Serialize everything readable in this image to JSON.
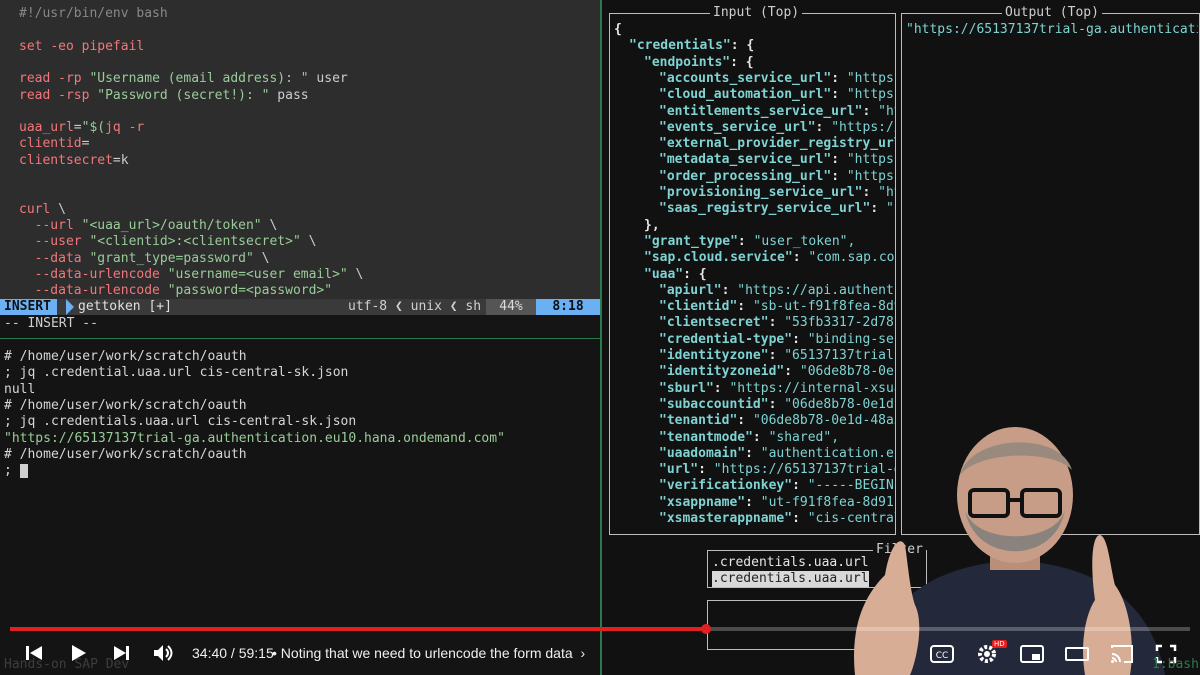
{
  "vim": {
    "lines": [
      {
        "parts": [
          {
            "t": "#!/usr/bin/env bash",
            "c": "com"
          }
        ]
      },
      {
        "parts": []
      },
      {
        "parts": [
          {
            "t": "set ",
            "c": "kw"
          },
          {
            "t": "-eo pipefail",
            "c": "kw"
          }
        ]
      },
      {
        "parts": []
      },
      {
        "parts": [
          {
            "t": "read ",
            "c": "kw"
          },
          {
            "t": "-rp ",
            "c": "kw"
          },
          {
            "t": "\"Username (email address): \"",
            "c": "str"
          },
          {
            "t": " user",
            "c": "plain"
          }
        ]
      },
      {
        "parts": [
          {
            "t": "read ",
            "c": "kw"
          },
          {
            "t": "-rsp ",
            "c": "kw"
          },
          {
            "t": "\"Password (secret!): \"",
            "c": "str"
          },
          {
            "t": " pass",
            "c": "plain"
          }
        ]
      },
      {
        "parts": []
      },
      {
        "parts": [
          {
            "t": "uaa_url",
            "c": "var"
          },
          {
            "t": "=",
            "c": "plain"
          },
          {
            "t": "\"$(",
            "c": "str"
          },
          {
            "t": "jq -r",
            "c": "kw"
          }
        ]
      },
      {
        "parts": [
          {
            "t": "clientid",
            "c": "var"
          },
          {
            "t": "=",
            "c": "plain"
          }
        ]
      },
      {
        "parts": [
          {
            "t": "clientsecret",
            "c": "var"
          },
          {
            "t": "=k",
            "c": "plain"
          }
        ]
      },
      {
        "parts": []
      },
      {
        "parts": []
      },
      {
        "parts": [
          {
            "t": "curl ",
            "c": "kw"
          },
          {
            "t": "\\",
            "c": "plain"
          }
        ]
      },
      {
        "parts": [
          {
            "t": "  --url ",
            "c": "kw"
          },
          {
            "t": "\"<uaa_url>/oauth/token\"",
            "c": "str"
          },
          {
            "t": " \\",
            "c": "plain"
          }
        ]
      },
      {
        "parts": [
          {
            "t": "  --user ",
            "c": "kw"
          },
          {
            "t": "\"<clientid>:<clientsecret>\"",
            "c": "str"
          },
          {
            "t": " \\",
            "c": "plain"
          }
        ]
      },
      {
        "parts": [
          {
            "t": "  --data ",
            "c": "kw"
          },
          {
            "t": "\"grant_type=password\"",
            "c": "str"
          },
          {
            "t": " \\",
            "c": "plain"
          }
        ]
      },
      {
        "parts": [
          {
            "t": "  --data-urlencode ",
            "c": "kw"
          },
          {
            "t": "\"username=<user email>\"",
            "c": "str"
          },
          {
            "t": " \\",
            "c": "plain"
          }
        ]
      },
      {
        "parts": [
          {
            "t": "  --data-urlencode ",
            "c": "kw"
          },
          {
            "t": "\"password=<password>\"",
            "c": "str"
          }
        ]
      }
    ],
    "status": {
      "mode": "INSERT",
      "filename": "gettoken [+]",
      "encoding": "utf-8 ❮ unix ❮ sh",
      "percent": "44%",
      "position": "8:18"
    },
    "cmdline": "-- INSERT --"
  },
  "terminal": {
    "lines": [
      {
        "t": "# /home/user/work/scratch/oauth",
        "c": ""
      },
      {
        "t": "; jq .credential.uaa.url cis-central-sk.json",
        "c": ""
      },
      {
        "t": "null",
        "c": ""
      },
      {
        "t": "# /home/user/work/scratch/oauth",
        "c": ""
      },
      {
        "t": "; jq .credentials.uaa.url cis-central-sk.json",
        "c": ""
      },
      {
        "t": "\"https://65137137trial-ga.authentication.eu10.hana.ondemand.com\"",
        "c": "tstr"
      },
      {
        "t": "# /home/user/work/scratch/oauth",
        "c": ""
      },
      {
        "t": "; ",
        "c": "",
        "cursor": true
      }
    ]
  },
  "jless": {
    "input_title": "Input (Top)",
    "output_title": "Output (Top)",
    "output_value": "\"https://65137137trial-ga.authenticati",
    "input_lines": [
      {
        "indent": 0,
        "k": "",
        "v": "{"
      },
      {
        "indent": 1,
        "k": "\"credentials\"",
        "v": ": {"
      },
      {
        "indent": 2,
        "k": "\"endpoints\"",
        "v": ": {"
      },
      {
        "indent": 3,
        "k": "\"accounts_service_url\"",
        "v": ": ",
        "s": "\"https:"
      },
      {
        "indent": 3,
        "k": "\"cloud_automation_url\"",
        "v": ": ",
        "s": "\"https:"
      },
      {
        "indent": 3,
        "k": "\"entitlements_service_url\"",
        "v": ": ",
        "s": "\"ht"
      },
      {
        "indent": 3,
        "k": "\"events_service_url\"",
        "v": ": ",
        "s": "\"https://"
      },
      {
        "indent": 3,
        "k": "\"external_provider_registry_url",
        "v": "",
        "s": ""
      },
      {
        "indent": 3,
        "k": "\"metadata_service_url\"",
        "v": ": ",
        "s": "\"https:"
      },
      {
        "indent": 3,
        "k": "\"order_processing_url\"",
        "v": ": ",
        "s": "\"https:"
      },
      {
        "indent": 3,
        "k": "\"provisioning_service_url\"",
        "v": ": ",
        "s": "\"ht"
      },
      {
        "indent": 3,
        "k": "\"saas_registry_service_url\"",
        "v": ": ",
        "s": "\"h"
      },
      {
        "indent": 2,
        "k": "",
        "v": "},"
      },
      {
        "indent": 2,
        "k": "\"grant_type\"",
        "v": ": ",
        "s": "\"user_token\","
      },
      {
        "indent": 2,
        "k": "\"sap.cloud.service\"",
        "v": ": ",
        "s": "\"com.sap.cor"
      },
      {
        "indent": 2,
        "k": "\"uaa\"",
        "v": ": {"
      },
      {
        "indent": 3,
        "k": "\"apiurl\"",
        "v": ": ",
        "s": "\"https://api.authenti"
      },
      {
        "indent": 3,
        "k": "\"clientid\"",
        "v": ": ",
        "s": "\"sb-ut-f91f8fea-8d9"
      },
      {
        "indent": 3,
        "k": "\"clientsecret\"",
        "v": ": ",
        "s": "\"53fb3317-2d78-"
      },
      {
        "indent": 3,
        "k": "\"credential-type\"",
        "v": ": ",
        "s": "\"binding-sec"
      },
      {
        "indent": 3,
        "k": "\"identityzone\"",
        "v": ": ",
        "s": "\"65137137trial-"
      },
      {
        "indent": 3,
        "k": "\"identityzoneid\"",
        "v": ": ",
        "s": "\"06de8b78-0e1"
      },
      {
        "indent": 3,
        "k": "\"sburl\"",
        "v": ": ",
        "s": "\"https://internal-xsua"
      },
      {
        "indent": 3,
        "k": "\"subaccountid\"",
        "v": ": ",
        "s": "\"06de8b78-0e1d-"
      },
      {
        "indent": 3,
        "k": "\"tenantid\"",
        "v": ": ",
        "s": "\"06de8b78-0e1d-48a5"
      },
      {
        "indent": 3,
        "k": "\"tenantmode\"",
        "v": ": ",
        "s": "\"shared\","
      },
      {
        "indent": 3,
        "k": "\"uaadomain\"",
        "v": ": ",
        "s": "\"authentication.eu"
      },
      {
        "indent": 3,
        "k": "\"url\"",
        "v": ": ",
        "s": "\"https://65137137trial-g"
      },
      {
        "indent": 3,
        "k": "\"verificationkey\"",
        "v": ": ",
        "s": "\"-----BEGIN"
      },
      {
        "indent": 3,
        "k": "\"xsappname\"",
        "v": ": ",
        "s": "\"ut-f91f8fea-8d91-"
      },
      {
        "indent": 3,
        "k": "\"xsmasterappname\"",
        "v": ": ",
        "s": "\"cis-central"
      }
    ],
    "filter_title": "Filter",
    "filter_lines": [
      ".credentials.uaa.url",
      ".credentials.uaa.url"
    ],
    "filter2_title": "r"
  },
  "player": {
    "time": "34:40 / 59:15",
    "chapter": "• Noting that we need to urlencode the form data",
    "played_fraction": 0.59,
    "hd_badge": "HD"
  },
  "watermark": "Hands-on SAP Dev",
  "bash_label": "1:bash*"
}
